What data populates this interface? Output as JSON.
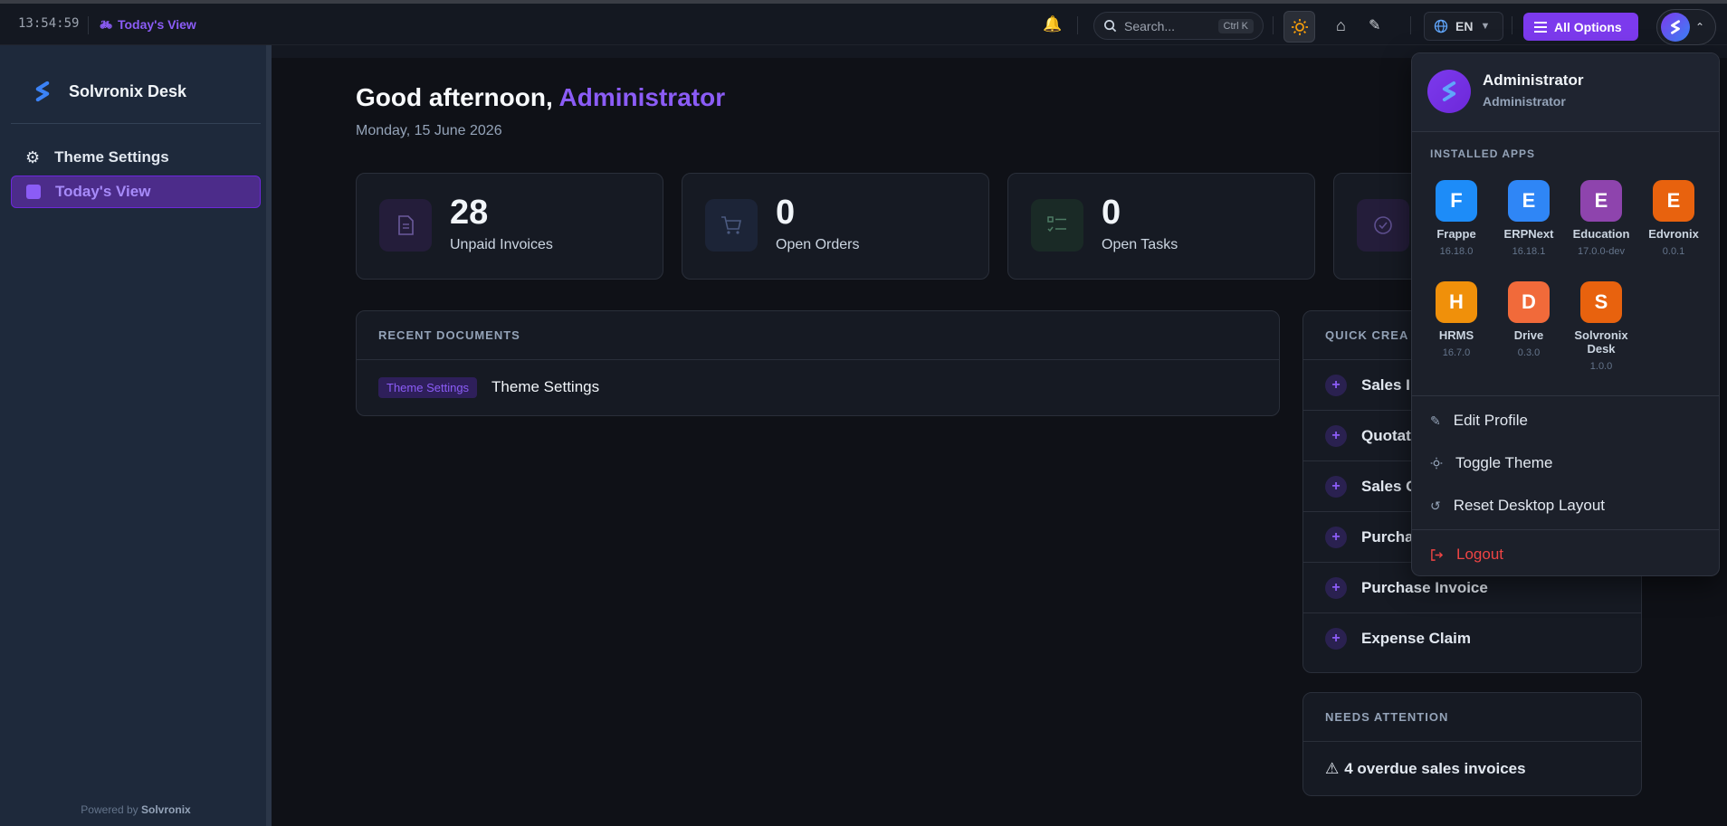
{
  "topbar": {
    "clock": "13:54:59",
    "breadcrumb": "Today's View",
    "search_placeholder": "Search...",
    "search_shortcut": "Ctrl K",
    "lang": "EN",
    "all_options": "All Options"
  },
  "sidebar": {
    "brand": "Solvronix Desk",
    "items": [
      {
        "label": "Theme Settings"
      },
      {
        "label": "Today's View"
      }
    ],
    "powered_prefix": "Powered by",
    "powered_brand": "Solvronix"
  },
  "main": {
    "greeting_prefix": "Good afternoon,",
    "greeting_name": "Administrator",
    "date": "Monday, 15 June 2026",
    "stats": [
      {
        "value": "28",
        "label": "Unpaid Invoices"
      },
      {
        "value": "0",
        "label": "Open Orders"
      },
      {
        "value": "0",
        "label": "Open Tasks"
      }
    ],
    "recent": {
      "title": "RECENT DOCUMENTS",
      "rows": [
        {
          "tag": "Theme Settings",
          "name": "Theme Settings"
        }
      ]
    },
    "quick_create": {
      "title": "QUICK CREA",
      "items": [
        "Sales I",
        "Quotat",
        "Sales C",
        "Purcha",
        "Purchase Invoice",
        "Expense Claim"
      ]
    },
    "attention": {
      "title": "NEEDS ATTENTION",
      "text": "4 overdue sales invoices"
    }
  },
  "dropdown": {
    "name": "Administrator",
    "role": "Administrator",
    "section": "INSTALLED APPS",
    "apps": [
      {
        "letter": "F",
        "name": "Frappe",
        "version": "16.18.0",
        "color": "#1d8cf8"
      },
      {
        "letter": "E",
        "name": "ERPNext",
        "version": "16.18.1",
        "color": "#2f86f6"
      },
      {
        "letter": "E",
        "name": "Education",
        "version": "17.0.0-dev",
        "color": "#8e44ad"
      },
      {
        "letter": "E",
        "name": "Edvronix",
        "version": "0.0.1",
        "color": "#e8620e"
      },
      {
        "letter": "H",
        "name": "HRMS",
        "version": "16.7.0",
        "color": "#f0900a"
      },
      {
        "letter": "D",
        "name": "Drive",
        "version": "0.3.0",
        "color": "#f16a3a"
      },
      {
        "letter": "S",
        "name": "Solvronix Desk",
        "version": "1.0.0",
        "color": "#e8620e"
      }
    ],
    "menu": {
      "edit_profile": "Edit Profile",
      "toggle_theme": "Toggle Theme",
      "reset_layout": "Reset Desktop Layout",
      "logout": "Logout"
    }
  }
}
